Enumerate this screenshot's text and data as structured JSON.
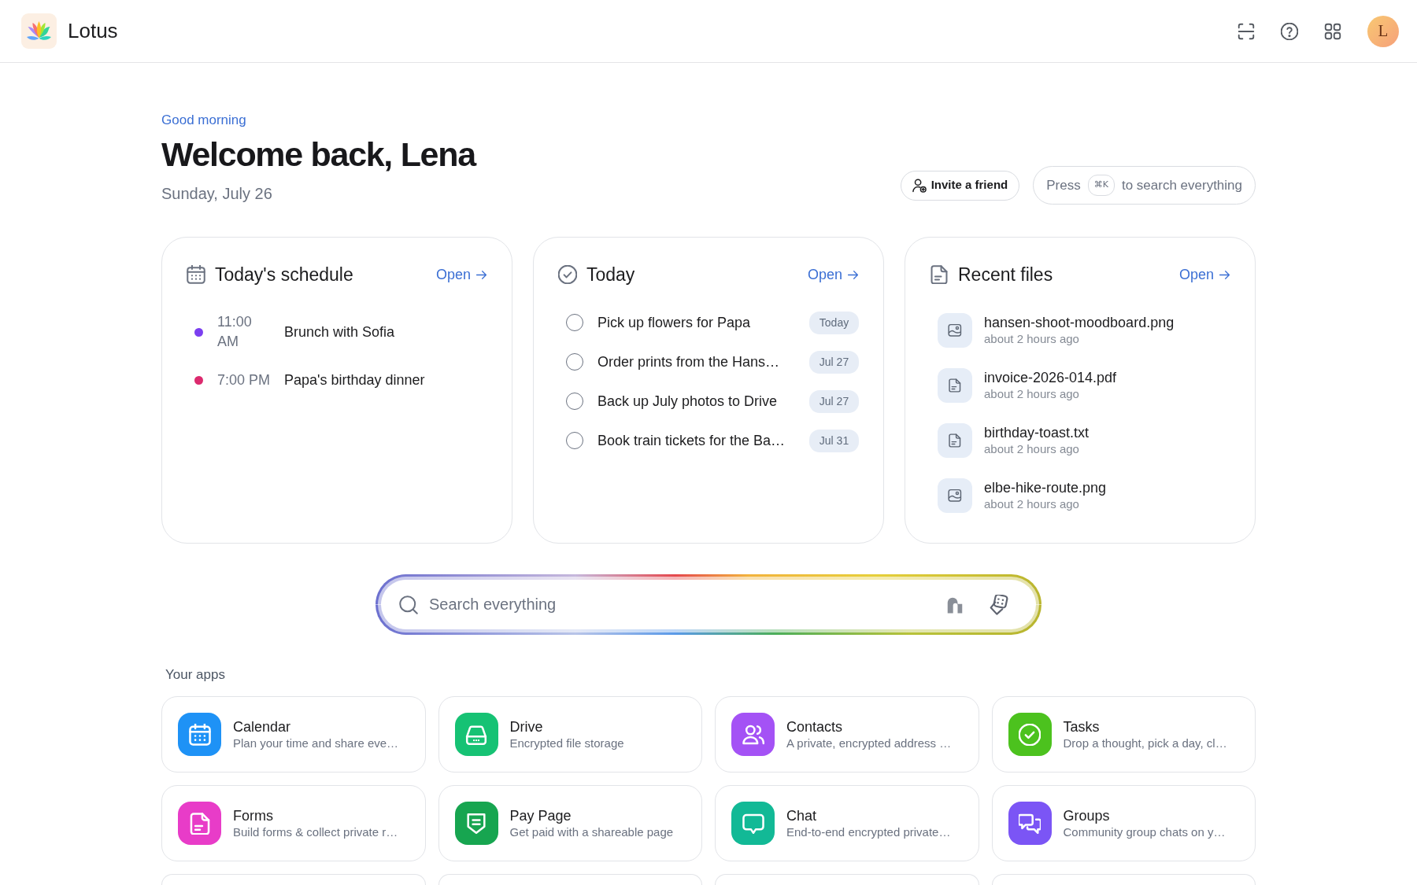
{
  "topbar": {
    "app_name": "Lotus",
    "avatar_initial": "L"
  },
  "header": {
    "greeting": "Good morning",
    "title": "Welcome back, Lena",
    "date": "Sunday, July 26",
    "invite_button": "Invite a friend",
    "search_hint": {
      "prefix": "Press",
      "shortcut": "⌘K",
      "suffix": "to search everything"
    }
  },
  "schedule": {
    "title": "Today's schedule",
    "link": "Open",
    "events": [
      {
        "time": "11:00 AM",
        "title": "Brunch with Sofia",
        "color": "#7b3ff0"
      },
      {
        "time": "7:00 PM",
        "title": "Papa's birthday dinner",
        "color": "#dc2a6e"
      }
    ]
  },
  "tasks": {
    "title": "Today",
    "link": "Open",
    "items": [
      {
        "text": "Pick up flowers for Papa",
        "due": "Today",
        "checked": false
      },
      {
        "text": "Order prints from the Hans…",
        "due": "Jul 27",
        "checked": false
      },
      {
        "text": "Back up July photos to Drive",
        "due": "Jul 27",
        "checked": false
      },
      {
        "text": "Book train tickets for the Ba…",
        "due": "Jul 31",
        "checked": false
      }
    ]
  },
  "files": {
    "title": "Recent files",
    "link": "Open",
    "items": [
      {
        "kind": "image",
        "name": "hansen-shoot-moodboard.png",
        "time": "about 2 hours ago"
      },
      {
        "kind": "document",
        "name": "invoice-2026-014.pdf",
        "time": "about 2 hours ago"
      },
      {
        "kind": "document",
        "name": "birthday-toast.txt",
        "time": "about 2 hours ago"
      },
      {
        "kind": "image",
        "name": "elbe-hike-route.png",
        "time": "about 2 hours ago"
      }
    ]
  },
  "search": {
    "placeholder": "Search everything"
  },
  "apps": {
    "title": "Your apps",
    "items": [
      {
        "kind": "calendar",
        "name": "Calendar",
        "description": "Plan your time and share eve…",
        "color": "#1e92f6"
      },
      {
        "kind": "drive",
        "name": "Drive",
        "description": "Encrypted file storage",
        "color": "#16c274"
      },
      {
        "kind": "contacts",
        "name": "Contacts",
        "description": "A private, encrypted address …",
        "color": "#a452f5"
      },
      {
        "kind": "tasks",
        "name": "Tasks",
        "description": "Drop a thought, pick a day, cl…",
        "color": "#4cc21e"
      },
      {
        "kind": "forms",
        "name": "Forms",
        "description": "Build forms & collect private r…",
        "color": "#e83cc8"
      },
      {
        "kind": "pay",
        "name": "Pay Page",
        "description": "Get paid with a shareable page",
        "color": "#17a550"
      },
      {
        "kind": "chat",
        "name": "Chat",
        "description": "End-to-end encrypted private…",
        "color": "#12b996"
      },
      {
        "kind": "groups",
        "name": "Groups",
        "description": "Community group chats on y…",
        "color": "#7b55f5"
      },
      {
        "kind": "stub"
      },
      {
        "kind": "stub"
      },
      {
        "kind": "stub"
      },
      {
        "kind": "stub"
      }
    ]
  }
}
